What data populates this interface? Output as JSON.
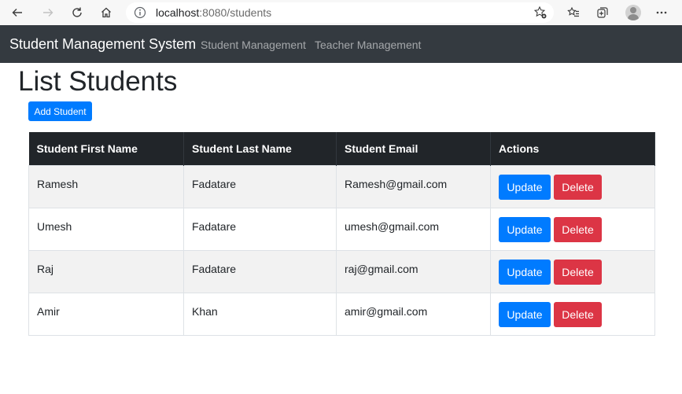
{
  "browser": {
    "url_host": "localhost",
    "url_rest": ":8080/students"
  },
  "navbar": {
    "brand": "Student Management System",
    "links": [
      "Student Management",
      "Teacher Management"
    ]
  },
  "page": {
    "title": "List Students",
    "add_button": "Add Student"
  },
  "table": {
    "headers": [
      "Student First Name",
      "Student Last Name",
      "Student Email",
      "Actions"
    ],
    "rows": [
      {
        "first": "Ramesh",
        "last": "Fadatare",
        "email": "Ramesh@gmail.com"
      },
      {
        "first": "Umesh",
        "last": "Fadatare",
        "email": "umesh@gmail.com"
      },
      {
        "first": "Raj",
        "last": "Fadatare",
        "email": "raj@gmail.com"
      },
      {
        "first": "Amir",
        "last": "Khan",
        "email": "amir@gmail.com"
      }
    ],
    "update_label": "Update",
    "delete_label": "Delete"
  },
  "colors": {
    "navbar": "#343a40",
    "primary": "#007bff",
    "danger": "#dc3545",
    "table_header": "#212529"
  }
}
